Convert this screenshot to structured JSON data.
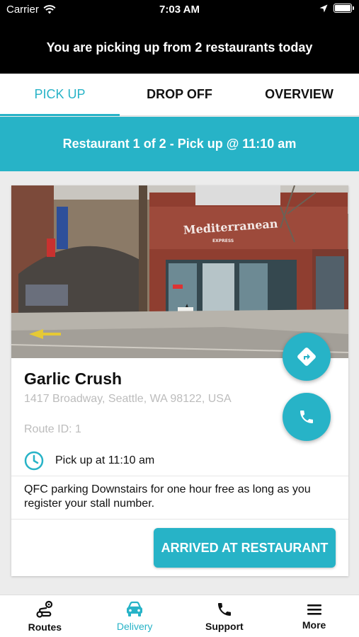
{
  "status_bar": {
    "carrier": "Carrier",
    "time": "7:03 AM"
  },
  "banner": {
    "text": "You are picking up from 2 restaurants today"
  },
  "tabs": [
    {
      "label": "PICK UP",
      "active": true
    },
    {
      "label": "DROP OFF",
      "active": false
    },
    {
      "label": "OVERVIEW",
      "active": false
    }
  ],
  "section": {
    "title": "Restaurant 1 of 2 - Pick up @ 11:10 am"
  },
  "restaurant": {
    "photo_sign": "Mediterranean",
    "photo_sign_sub": "EXPRESS",
    "name": "Garlic Crush",
    "address": "1417 Broadway, Seattle, WA 98122, USA",
    "route_id": "Route ID: 1",
    "pickup_time": "Pick up at 11:10 am",
    "note": "QFC parking Downstairs for one hour free as long as you register your stall number.",
    "arrived_label": "ARRIVED AT RESTAURANT"
  },
  "bottom_nav": [
    {
      "label": "Routes",
      "icon": "routes-icon",
      "active": false
    },
    {
      "label": "Delivery",
      "icon": "car-icon",
      "active": true
    },
    {
      "label": "Support",
      "icon": "phone-icon",
      "active": false
    },
    {
      "label": "More",
      "icon": "menu-icon",
      "active": false
    }
  ],
  "colors": {
    "accent": "#27b3c7",
    "banner_bg": "#000000"
  }
}
